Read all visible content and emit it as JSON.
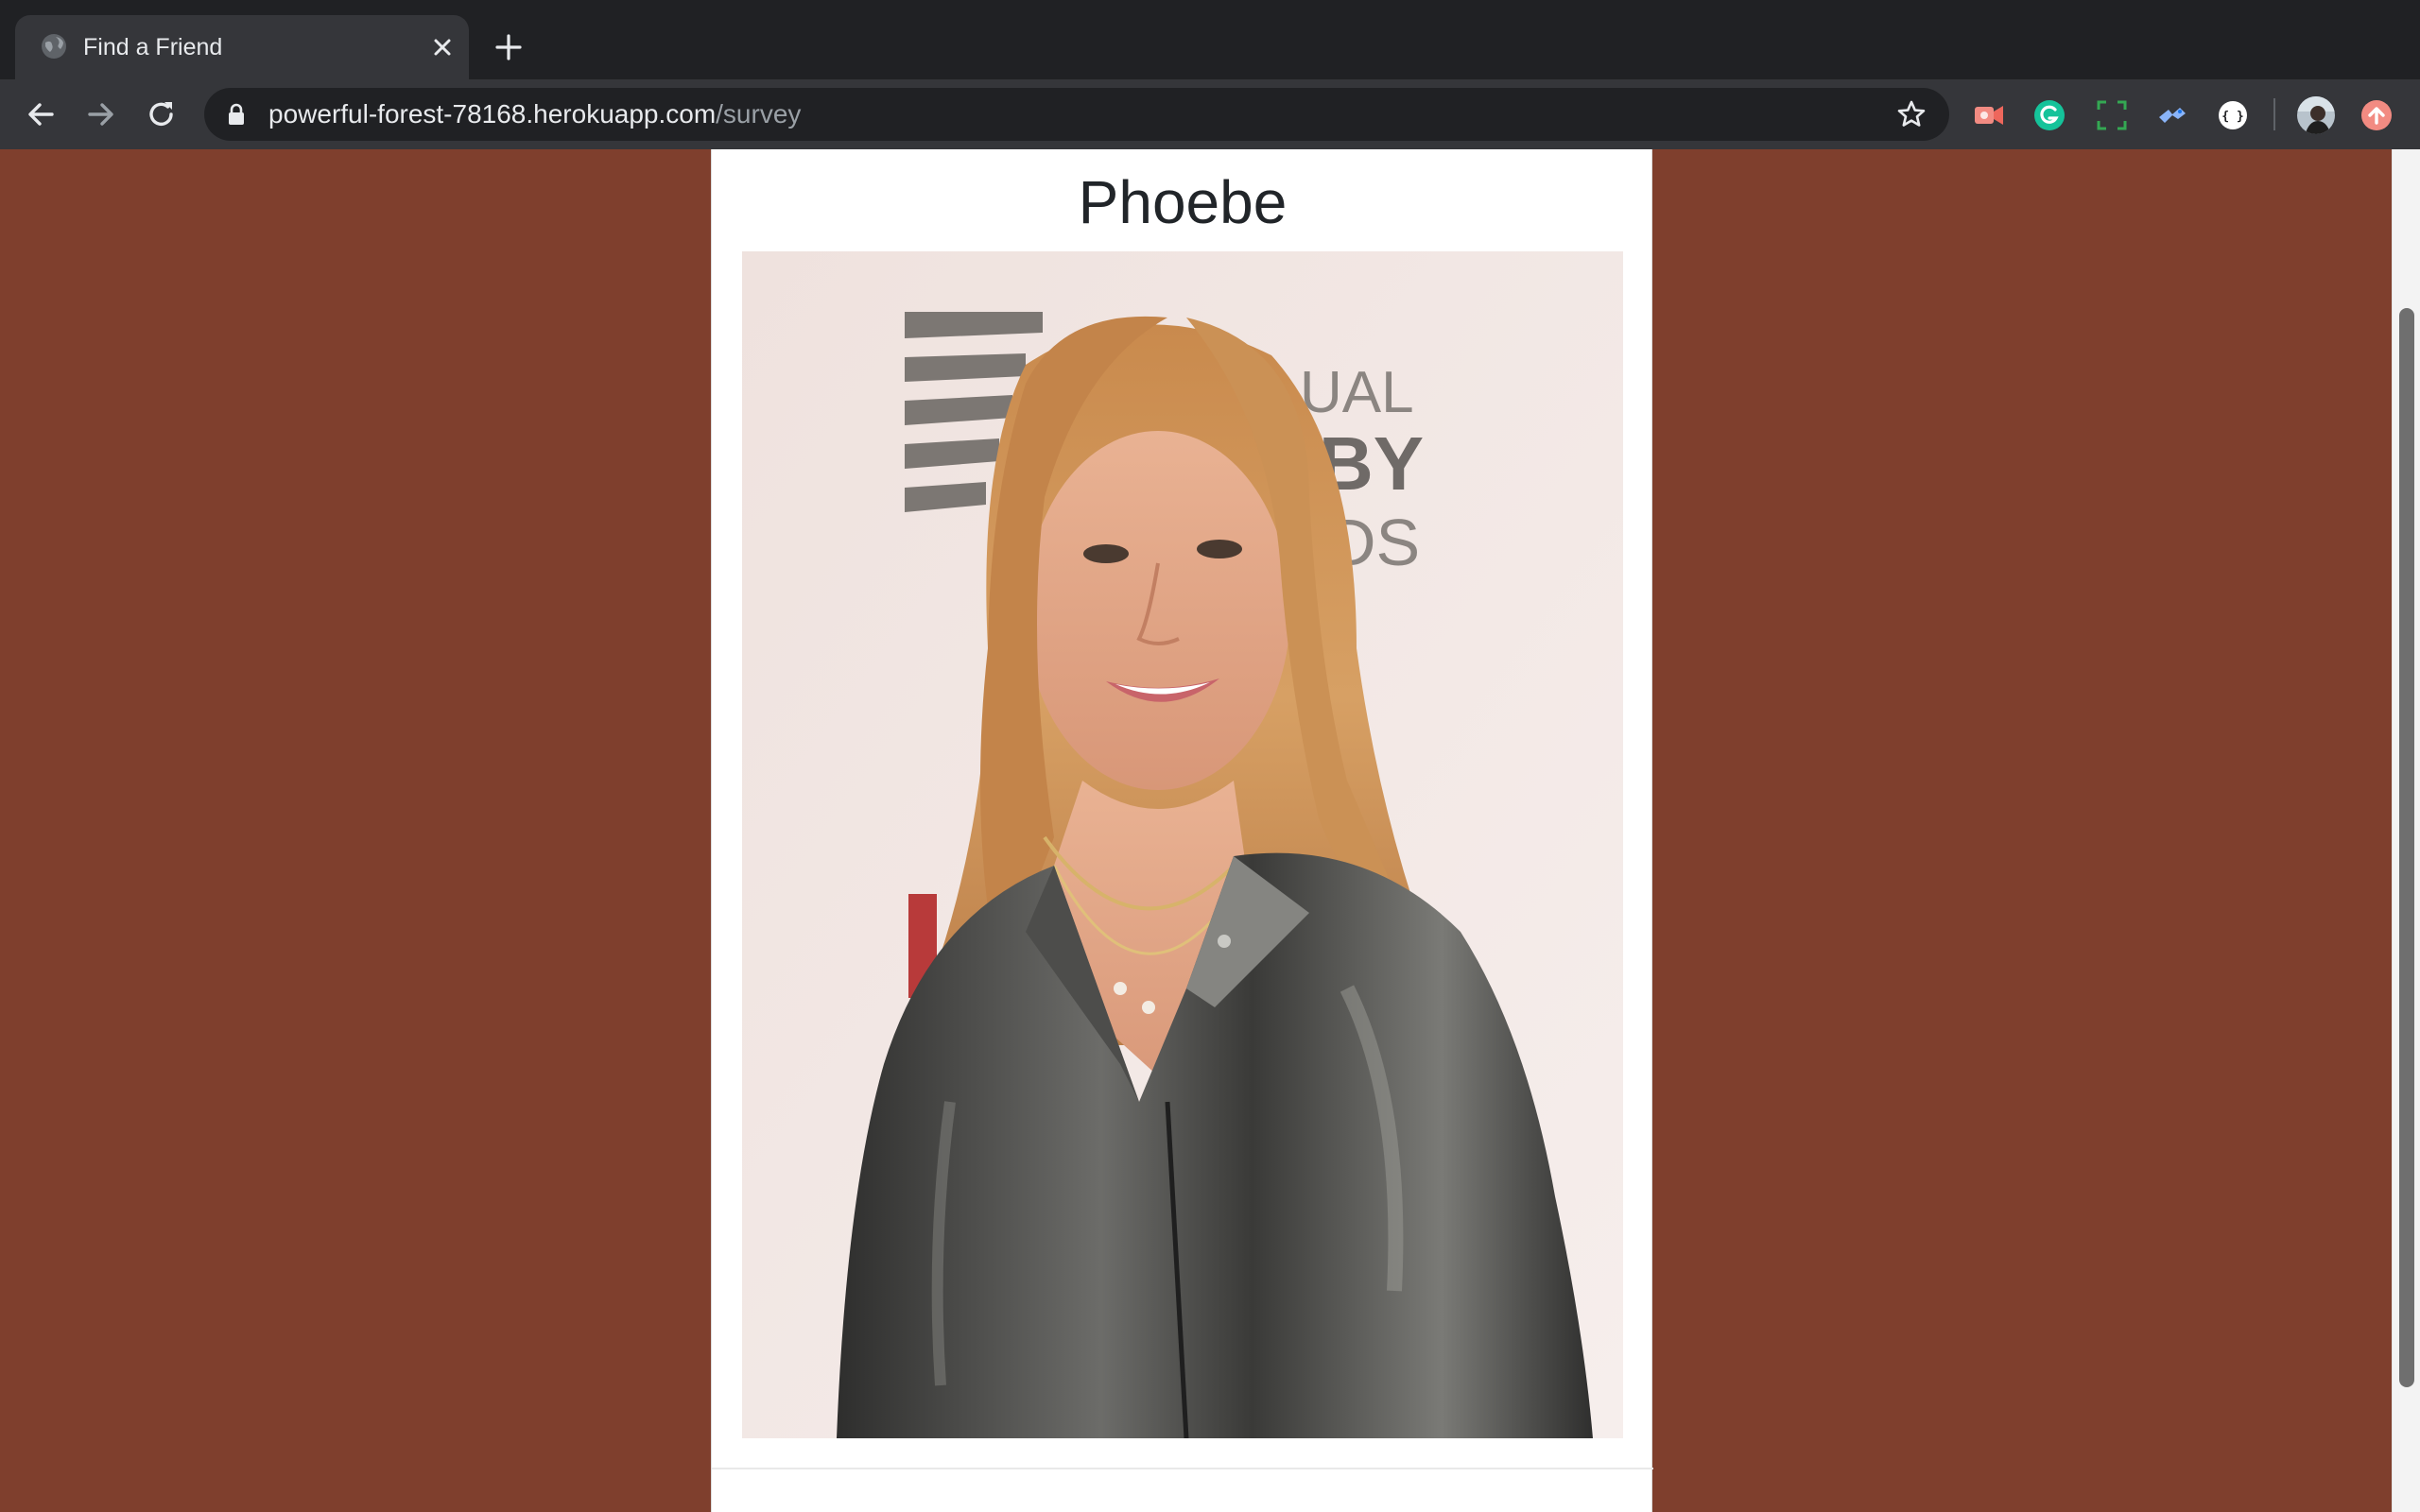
{
  "browser": {
    "tab": {
      "title": "Find a Friend",
      "favicon": "globe-icon"
    },
    "address_bar": {
      "domain": "powerful-forest-78168.herokuapp.com",
      "path": "/survey"
    },
    "extensions": [
      "video-record-extension-icon",
      "grammarly-extension-icon",
      "screenshot-extension-icon",
      "bird-extension-icon",
      "json-extension-icon",
      "profile-avatar",
      "update-icon"
    ]
  },
  "page": {
    "background_color": "#7f3f2d",
    "result_card": {
      "name": "Phoebe",
      "photo_alt": "Phoebe",
      "backdrop_text": [
        "UAL",
        "BY",
        "DS"
      ]
    }
  }
}
